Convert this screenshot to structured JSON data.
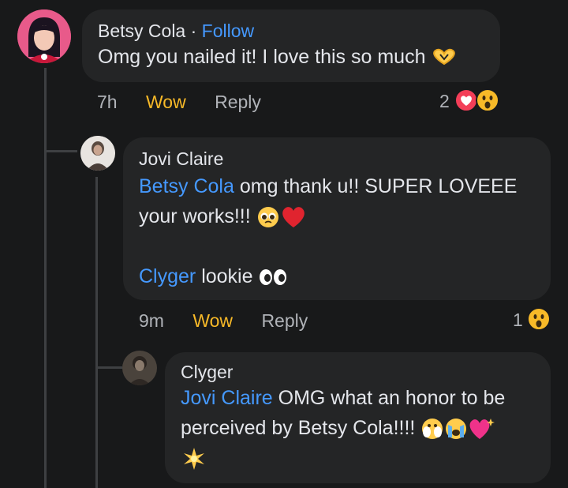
{
  "comments": [
    {
      "author": "Betsy Cola",
      "separator": " · ",
      "follow_label": "Follow",
      "text": "Omg you nailed it! I love this so much",
      "time": "7h",
      "wow_label": "Wow",
      "reply_label": "Reply",
      "reaction_count": "2"
    },
    {
      "author": "Jovi Claire",
      "mention1": "Betsy Cola",
      "text1a": " omg thank u!! SUPER LOVEEE",
      "text1b": "your works!!!",
      "mention2": "Clyger",
      "text2": " lookie",
      "time": "9m",
      "wow_label": "Wow",
      "reply_label": "Reply",
      "reaction_count": "1"
    },
    {
      "author": "Clyger",
      "mention": "Jovi Claire",
      "text1": " OMG what an honor to be",
      "text2": "perceived by Betsy Cola!!!!"
    }
  ],
  "colors": {
    "background": "#18191a",
    "bubble": "#242526",
    "accent": "#4599ff",
    "wow": "#f7b928"
  }
}
